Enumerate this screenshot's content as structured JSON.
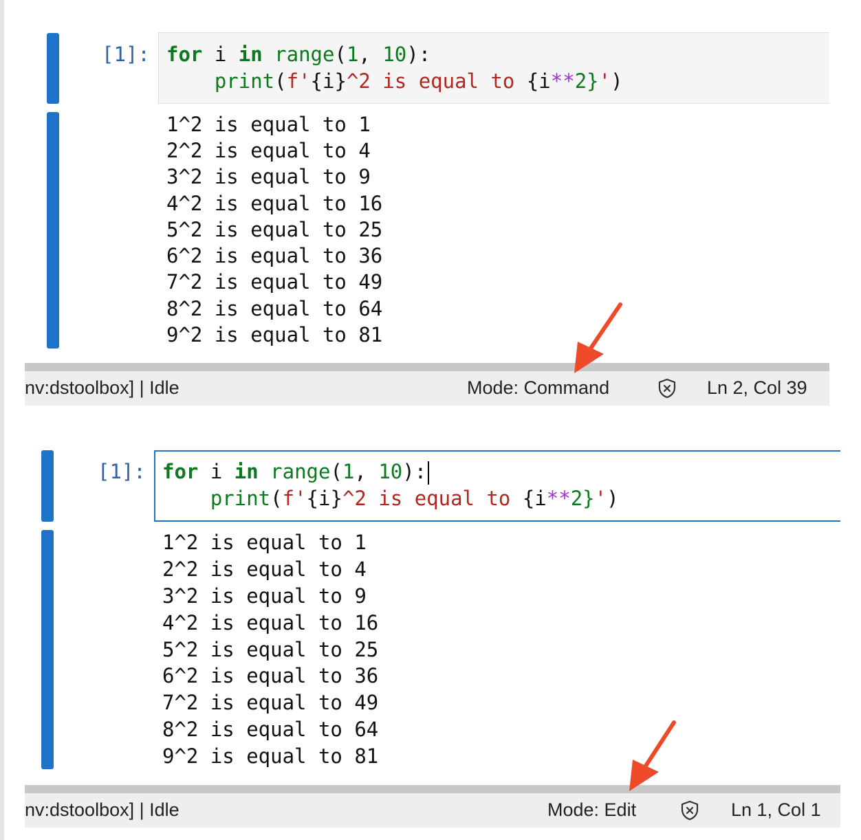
{
  "top": {
    "prompt": "[1]:",
    "code": {
      "kw_for": "for",
      "var_i": " i ",
      "kw_in": "in",
      "range_fn": " range",
      "paren_open": "(",
      "num_1": "1",
      "comma": ", ",
      "num_10": "10",
      "paren_close_colon": "):",
      "indent": "    ",
      "print_fn": "print",
      "print_open": "(",
      "fstr_start": "f'",
      "brace_i": "{i}",
      "str_mid": "^2 is equal to ",
      "brace_open": "{i",
      "op_pow": "**",
      "two": "2}",
      "str_end": "'",
      "print_close": ")"
    },
    "output": [
      "1^2 is equal to 1",
      "2^2 is equal to 4",
      "3^2 is equal to 9",
      "4^2 is equal to 16",
      "5^2 is equal to 25",
      "6^2 is equal to 36",
      "7^2 is equal to 49",
      "8^2 is equal to 64",
      "9^2 is equal to 81"
    ],
    "status": {
      "kernel": "nv:dstoolbox] | Idle",
      "mode": "Mode: Command",
      "position": "Ln 2, Col 39"
    }
  },
  "bottom": {
    "prompt": "[1]:",
    "code": {
      "kw_for": "for",
      "var_i": " i ",
      "kw_in": "in",
      "range_fn": " range",
      "paren_open": "(",
      "num_1": "1",
      "comma": ", ",
      "num_10": "10",
      "paren_close_colon": "):",
      "indent": "    ",
      "print_fn": "print",
      "print_open": "(",
      "fstr_start": "f'",
      "brace_i": "{i}",
      "str_mid": "^2 is equal to ",
      "brace_open": "{i",
      "op_pow": "**",
      "two": "2}",
      "str_end": "'",
      "print_close": ")"
    },
    "output": [
      "1^2 is equal to 1",
      "2^2 is equal to 4",
      "3^2 is equal to 9",
      "4^2 is equal to 16",
      "5^2 is equal to 25",
      "6^2 is equal to 36",
      "7^2 is equal to 49",
      "8^2 is equal to 64",
      "9^2 is equal to 81"
    ],
    "status": {
      "kernel": "nv:dstoolbox] | Idle",
      "mode": "Mode: Edit",
      "position": "Ln 1, Col 1"
    }
  },
  "colors": {
    "cell_bar": "#1e73c8",
    "keyword": "#0b7a1e",
    "string": "#b3261e",
    "operator": "#a030d8",
    "prompt": "#3060a8",
    "arrow": "#ee4a2a"
  },
  "icons": [
    "shield-x-icon",
    "annotation-arrow"
  ]
}
